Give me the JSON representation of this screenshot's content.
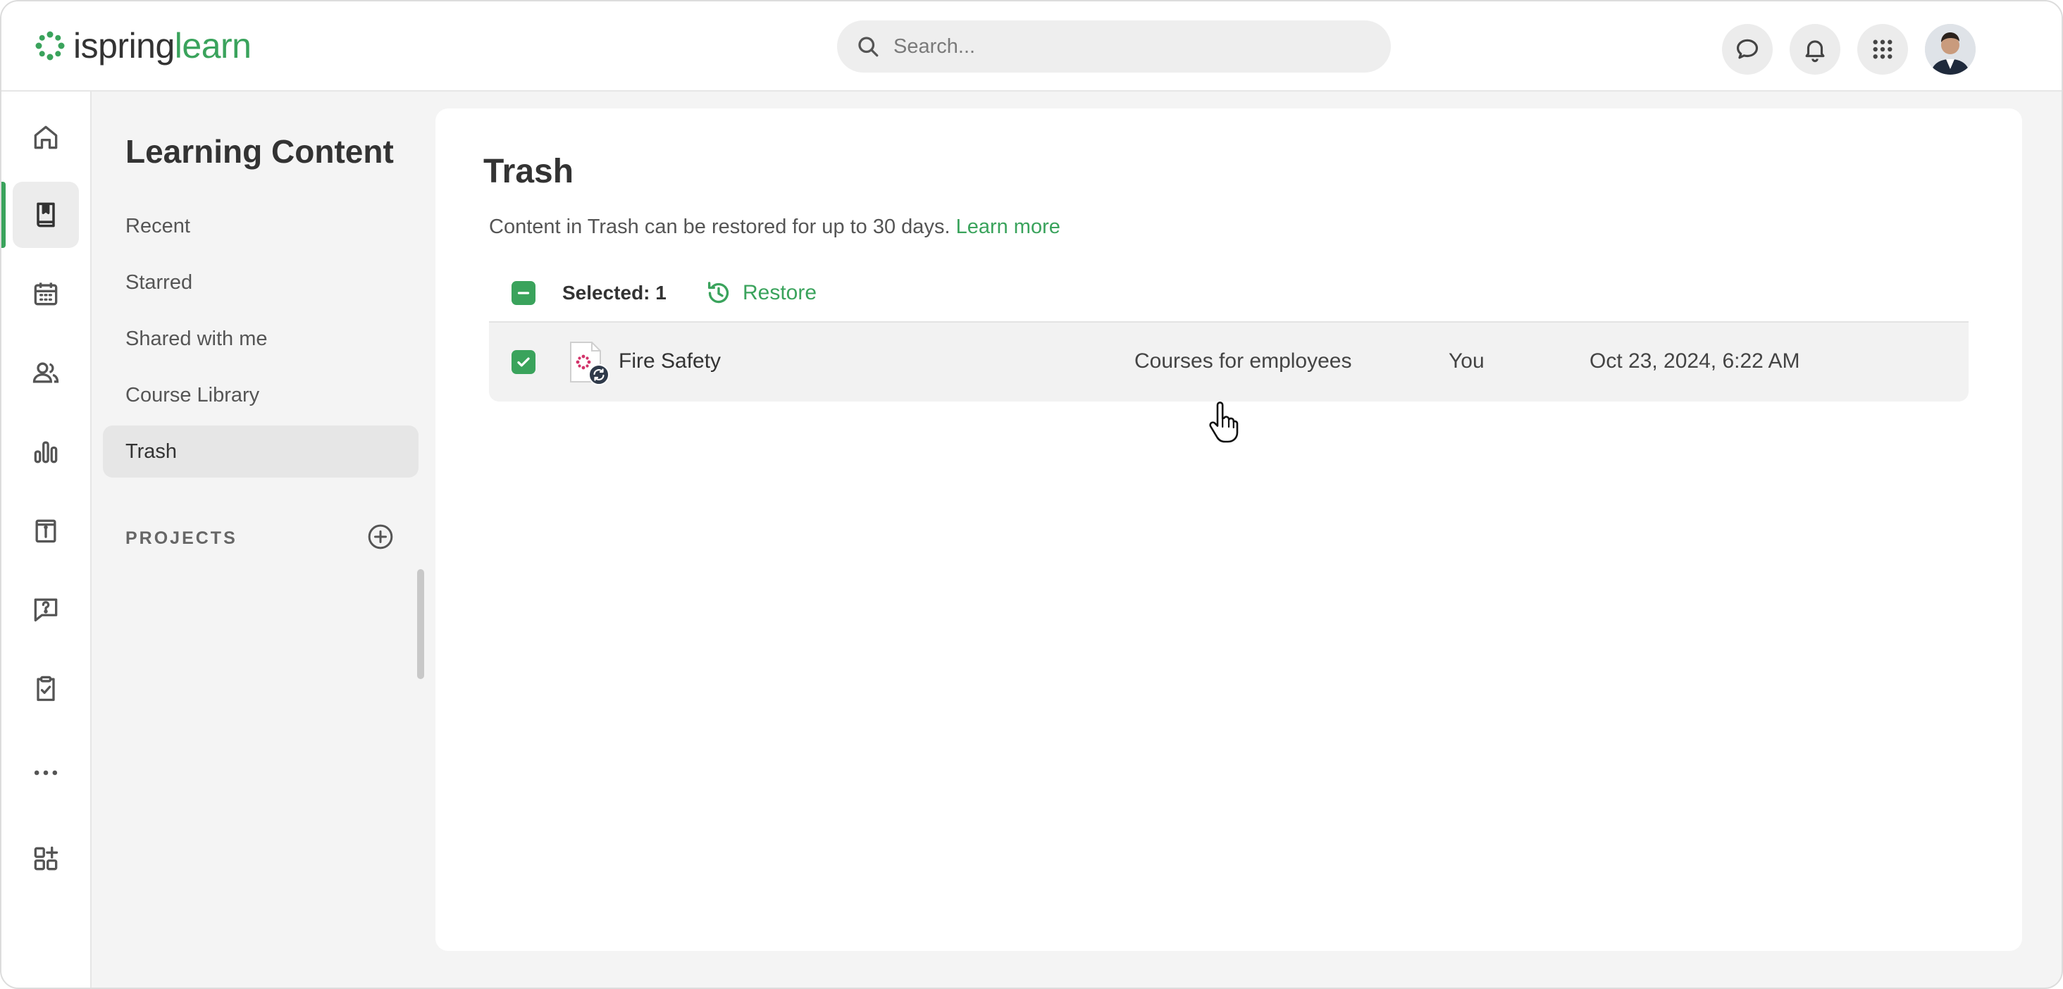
{
  "header": {
    "logo": {
      "part1": "ispring",
      "part2": "learn"
    },
    "search": {
      "placeholder": "Search..."
    },
    "icons": [
      "chat-icon",
      "bell-icon",
      "apps-grid-icon"
    ],
    "colors": {
      "brand": "#3aa35c"
    }
  },
  "rail": {
    "items": [
      "home-icon",
      "content-icon",
      "calendar-icon",
      "users-icon",
      "reports-icon",
      "info-board-icon",
      "help-chat-icon",
      "assignments-icon",
      "more-icon",
      "add-widget-icon"
    ],
    "active": "content-icon"
  },
  "subnav": {
    "title": "Learning Content",
    "items": [
      {
        "label": "Recent"
      },
      {
        "label": "Starred"
      },
      {
        "label": "Shared with me"
      },
      {
        "label": "Course Library"
      },
      {
        "label": "Trash"
      }
    ],
    "active_item": "Trash",
    "projects_label": "PROJECTS"
  },
  "main": {
    "title": "Trash",
    "info_text": "Content in Trash can be restored for up to 30 days.",
    "learn_more": "Learn more",
    "toolbar": {
      "selected_label": "Selected: 1",
      "restore_label": "Restore"
    },
    "rows": [
      {
        "name": "Fire Safety",
        "folder": "Courses for employees",
        "owner": "You",
        "date": "Oct 23, 2024, 6:22 AM",
        "checked": true
      }
    ]
  }
}
